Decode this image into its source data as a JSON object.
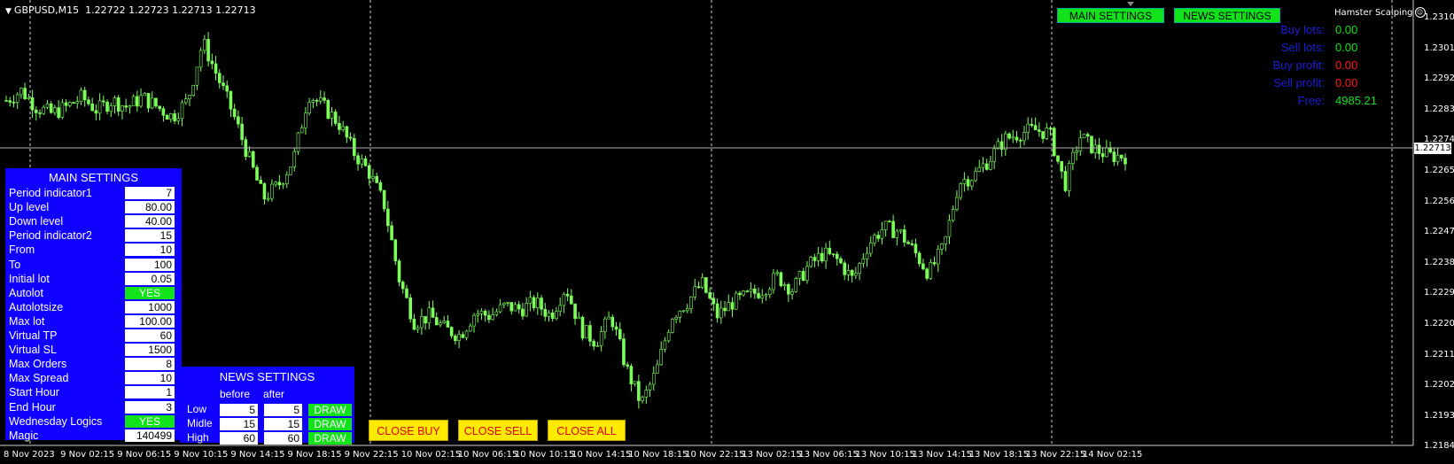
{
  "chart": {
    "symbol": "GBPUSD,M15",
    "ohlc": "1.22722 1.22723 1.22713 1.22713",
    "current_price_label": "1.22713",
    "candle_color": "#7dff5a",
    "grid_color": "#cfcfcf",
    "y_axis_ticks": [
      "1.23100",
      "1.23010",
      "1.22920",
      "1.22830",
      "1.22740",
      "1.22655",
      "1.22560",
      "1.22470",
      "1.22380",
      "1.22290",
      "1.22200",
      "1.22110",
      "1.22020",
      "1.21930",
      "1.21840"
    ],
    "x_axis_ticks": [
      "8 Nov 2023",
      "9 Nov 02:15",
      "9 Nov 06:15",
      "9 Nov 10:15",
      "9 Nov 14:15",
      "9 Nov 18:15",
      "9 Nov 22:15",
      "10 Nov 02:15",
      "10 Nov 06:15",
      "10 Nov 10:15",
      "10 Nov 14:15",
      "10 Nov 18:15",
      "10 Nov 22:15",
      "13 Nov 02:15",
      "13 Nov 06:15",
      "13 Nov 10:15",
      "13 Nov 14:15",
      "13 Nov 18:15",
      "13 Nov 22:15",
      "14 Nov 02:15"
    ],
    "price_path": [
      1.2288,
      1.2291,
      1.2286,
      1.2284,
      1.2286,
      1.2289,
      1.2285,
      1.2288,
      1.2286,
      1.2289,
      1.2286,
      1.2283,
      1.2288,
      1.2306,
      1.2295,
      1.2284,
      1.2271,
      1.2258,
      1.2262,
      1.227,
      1.229,
      1.2286,
      1.2281,
      1.2272,
      1.2266,
      1.2256,
      1.2233,
      1.222,
      1.2222,
      1.2218,
      1.2216,
      1.2223,
      1.2222,
      1.2225,
      1.2224,
      1.2226,
      1.2222,
      1.2231,
      1.2218,
      1.2214,
      1.2222,
      1.2206,
      1.2195,
      1.2205,
      1.2222,
      1.2226,
      1.2232,
      1.2222,
      1.2226,
      1.2228,
      1.223,
      1.2234,
      1.223,
      1.2237,
      1.2241,
      1.2239,
      1.2233,
      1.2244,
      1.2249,
      1.2248,
      1.2242,
      1.2235,
      1.2243,
      1.2263,
      1.2265,
      1.227,
      1.2276,
      1.2278,
      1.2279,
      1.2278,
      1.2262,
      1.2277,
      1.2273,
      1.2271,
      1.2271
    ]
  },
  "ea": {
    "name": "Hamster Scalping"
  },
  "top_buttons": {
    "main": "MAIN SETTINGS",
    "news": "NEWS SETTINGS"
  },
  "info": [
    {
      "label": "Buy lots:",
      "value": "0.00",
      "color": "#11e21a"
    },
    {
      "label": "Sell lots:",
      "value": "0.00",
      "color": "#11e21a"
    },
    {
      "label": "Buy profit:",
      "value": "0.00",
      "color": "#ff1a1a"
    },
    {
      "label": "Sell profit:",
      "value": "0.00",
      "color": "#ff1a1a"
    },
    {
      "label": "Free:",
      "value": "4985.21",
      "color": "#11e21a"
    }
  ],
  "main_settings": {
    "title": "MAIN SETTINGS",
    "rows": [
      {
        "label": "Period indicator1",
        "value": "7"
      },
      {
        "label": "Up level",
        "value": "80.00"
      },
      {
        "label": "Down level",
        "value": "40.00"
      },
      {
        "label": "Period indicator2",
        "value": "15"
      },
      {
        "label": "From",
        "value": "10"
      },
      {
        "label": "To",
        "value": "100"
      },
      {
        "label": "Initial lot",
        "value": "0.05"
      },
      {
        "label": "Autolot",
        "value": "YES",
        "toggle": true
      },
      {
        "label": "Autolotsize",
        "value": "1000"
      },
      {
        "label": "Max lot",
        "value": "100.00"
      },
      {
        "label": "Virtual TP",
        "value": "60"
      },
      {
        "label": "Virtual SL",
        "value": "1500"
      },
      {
        "label": "Max Orders",
        "value": "8"
      },
      {
        "label": "Max Spread",
        "value": "10"
      },
      {
        "label": "Start Hour",
        "value": "1"
      },
      {
        "label": "End Hour",
        "value": "3"
      },
      {
        "label": "Wednesday Logics",
        "value": "YES",
        "toggle": true
      },
      {
        "label": "Magic",
        "value": "140499"
      }
    ]
  },
  "news_settings": {
    "title": "NEWS SETTINGS",
    "col_before": "before",
    "col_after": "after",
    "rows": [
      {
        "label": "Low",
        "before": "5",
        "after": "5",
        "action": "DRAW"
      },
      {
        "label": "Midle",
        "before": "15",
        "after": "15",
        "action": "DRAW"
      },
      {
        "label": "High",
        "before": "60",
        "after": "60",
        "action": "DRAW"
      }
    ]
  },
  "actions": {
    "close_buy": "CLOSE BUY",
    "close_sell": "CLOSE SELL",
    "close_all": "CLOSE ALL"
  }
}
